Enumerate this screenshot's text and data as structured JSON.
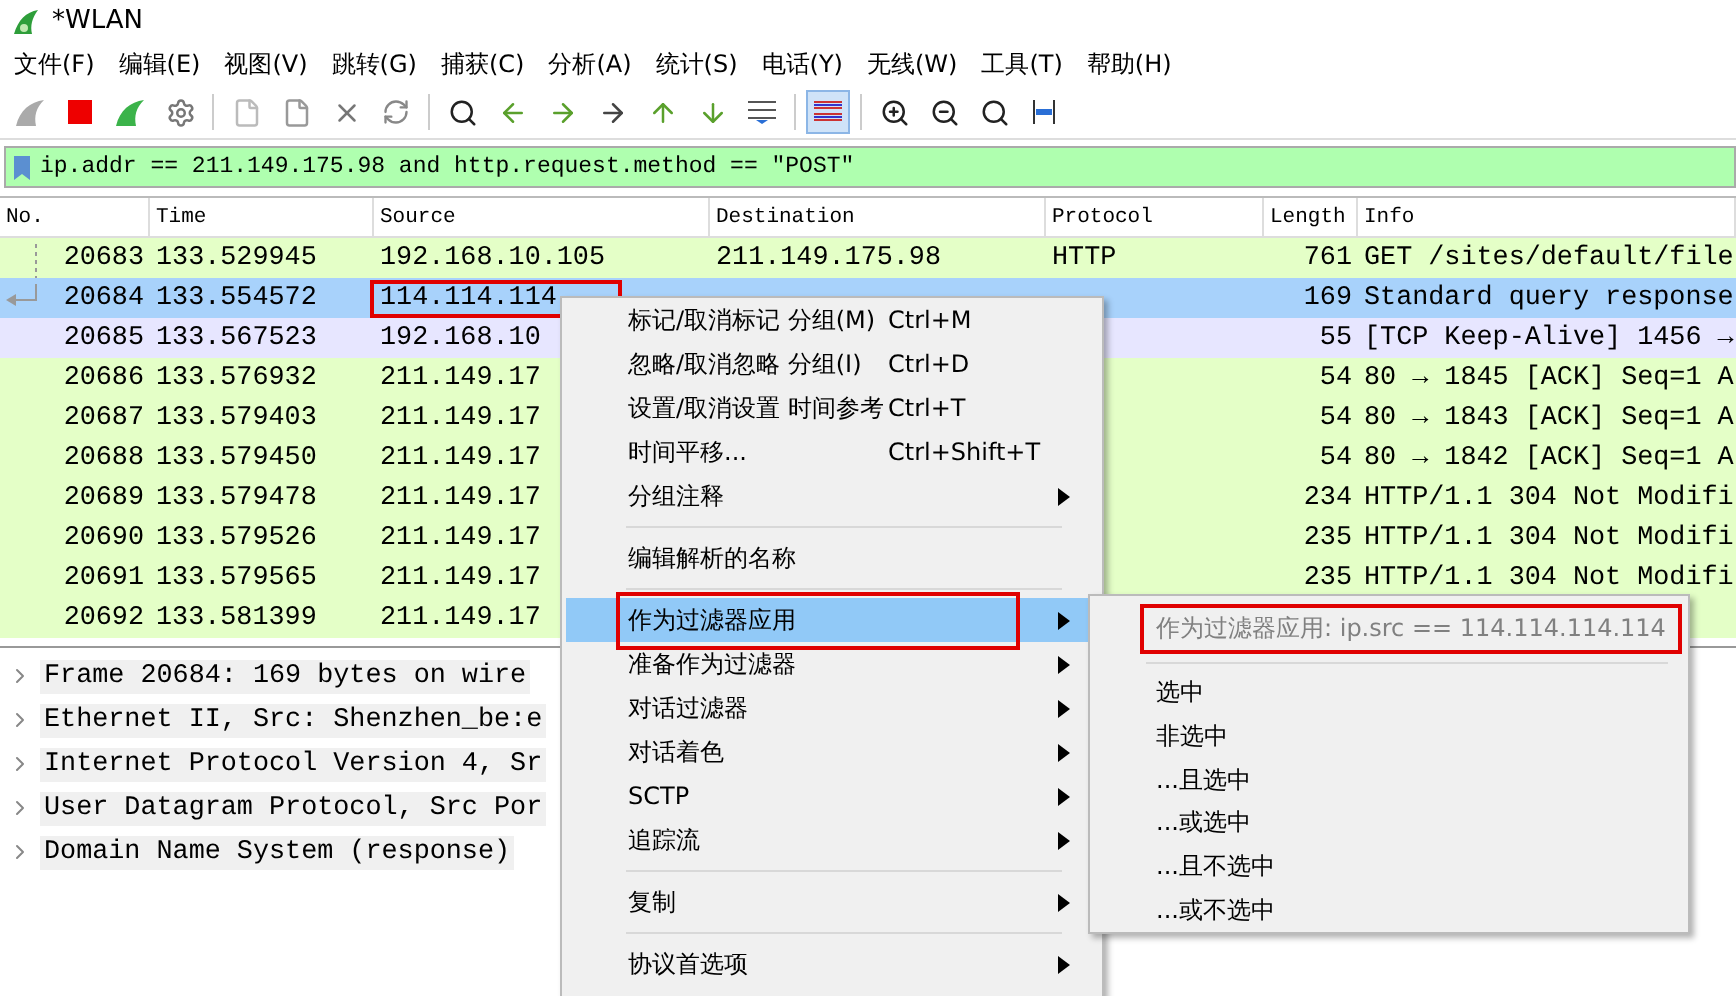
{
  "window": {
    "title": "*WLAN"
  },
  "menubar": [
    "文件(F)",
    "编辑(E)",
    "视图(V)",
    "跳转(G)",
    "捕获(C)",
    "分析(A)",
    "统计(S)",
    "电话(Y)",
    "无线(W)",
    "工具(T)",
    "帮助(H)"
  ],
  "filter": {
    "value": "ip.addr == 211.149.175.98 and http.request.method == \"POST\""
  },
  "table": {
    "columns": [
      "No.",
      "Time",
      "Source",
      "Destination",
      "Protocol",
      "Length",
      "Info"
    ],
    "rows": [
      {
        "cells": [
          "20683",
          "133.529945",
          "192.168.10.105",
          "211.149.175.98",
          "HTTP",
          "761",
          "GET /sites/default/file"
        ],
        "color": "#e4ffc7",
        "selected": false,
        "highlighted": false
      },
      {
        "cells": [
          "20684",
          "133.554572",
          "114.114.114",
          "",
          "",
          "169",
          "Standard query response"
        ],
        "selected": true,
        "highlighted": true
      },
      {
        "cells": [
          "20685",
          "133.567523",
          "192.168.10",
          "",
          "",
          "55",
          "[TCP Keep-Alive] 1456 →"
        ],
        "color": "#e7e6ff",
        "selected": false,
        "highlighted": false
      },
      {
        "cells": [
          "20686",
          "133.576932",
          "211.149.17",
          "",
          "",
          "54",
          "80 → 1845 [ACK] Seq=1 A"
        ],
        "color": "#e4ffc7",
        "selected": false,
        "highlighted": false
      },
      {
        "cells": [
          "20687",
          "133.579403",
          "211.149.17",
          "",
          "",
          "54",
          "80 → 1843 [ACK] Seq=1 A"
        ],
        "color": "#e4ffc7",
        "selected": false,
        "highlighted": false
      },
      {
        "cells": [
          "20688",
          "133.579450",
          "211.149.17",
          "",
          "",
          "54",
          "80 → 1842 [ACK] Seq=1 A"
        ],
        "color": "#e4ffc7",
        "selected": false,
        "highlighted": false
      },
      {
        "cells": [
          "20689",
          "133.579478",
          "211.149.17",
          "",
          "",
          "234",
          "HTTP/1.1 304 Not Modifi"
        ],
        "color": "#e4ffc7",
        "selected": false,
        "highlighted": false
      },
      {
        "cells": [
          "20690",
          "133.579526",
          "211.149.17",
          "",
          "",
          "235",
          "HTTP/1.1 304 Not Modifi"
        ],
        "color": "#e4ffc7",
        "selected": false,
        "highlighted": false
      },
      {
        "cells": [
          "20691",
          "133.579565",
          "211.149.17",
          "",
          "",
          "235",
          "HTTP/1.1 304 Not Modifi"
        ],
        "color": "#e4ffc7",
        "selected": false,
        "highlighted": false
      },
      {
        "cells": [
          "20692",
          "133.581399",
          "211.149.17",
          "",
          "",
          "",
          ""
        ],
        "color": "#e4ffc7",
        "selected": false,
        "highlighted": false
      }
    ]
  },
  "details": [
    {
      "text": "Frame 20684: 169 bytes on wire",
      "expanded": false
    },
    {
      "text": "Ethernet II, Src: Shenzhen_be:e",
      "expanded": false
    },
    {
      "text": "Internet Protocol Version 4, Sr",
      "expanded": false
    },
    {
      "text": "User Datagram Protocol, Src Por",
      "expanded": false
    },
    {
      "text": "Domain Name System (response)",
      "expanded": false
    }
  ],
  "context_menu": {
    "items": [
      {
        "kind": "item",
        "label": "标记/取消标记 分组(M)",
        "shortcut": "Ctrl+M",
        "submenu": false,
        "selected": false,
        "highlighted": false
      },
      {
        "kind": "item",
        "label": "忽略/取消忽略 分组(I)",
        "shortcut": "Ctrl+D",
        "submenu": false,
        "selected": false,
        "highlighted": false
      },
      {
        "kind": "item",
        "label": "设置/取消设置 时间参考",
        "shortcut": "Ctrl+T",
        "submenu": false,
        "selected": false,
        "highlighted": false
      },
      {
        "kind": "item",
        "label": "时间平移...",
        "shortcut": "Ctrl+Shift+T",
        "submenu": false,
        "selected": false,
        "highlighted": false
      },
      {
        "kind": "item",
        "label": "分组注释",
        "submenu": true,
        "selected": false,
        "highlighted": false
      },
      {
        "kind": "separator"
      },
      {
        "kind": "item",
        "label": "编辑解析的名称",
        "submenu": false,
        "selected": false,
        "highlighted": false
      },
      {
        "kind": "separator"
      },
      {
        "kind": "item",
        "label": "作为过滤器应用",
        "submenu": true,
        "selected": true,
        "highlighted": true
      },
      {
        "kind": "item",
        "label": "准备作为过滤器",
        "submenu": true,
        "selected": false,
        "highlighted": false
      },
      {
        "kind": "item",
        "label": "对话过滤器",
        "submenu": true,
        "selected": false,
        "highlighted": false
      },
      {
        "kind": "item",
        "label": "对话着色",
        "submenu": true,
        "selected": false,
        "highlighted": false
      },
      {
        "kind": "item",
        "label": "SCTP",
        "submenu": true,
        "selected": false,
        "highlighted": false
      },
      {
        "kind": "item",
        "label": "追踪流",
        "submenu": true,
        "selected": false,
        "highlighted": false
      },
      {
        "kind": "separator"
      },
      {
        "kind": "item",
        "label": "复制",
        "submenu": true,
        "selected": false,
        "highlighted": false
      },
      {
        "kind": "separator"
      },
      {
        "kind": "item",
        "label": "协议首选项",
        "submenu": true,
        "selected": false,
        "highlighted": false
      }
    ]
  },
  "submenu": {
    "header": {
      "label": "作为过滤器应用: ip.src == 114.114.114.114",
      "disabled": true,
      "highlighted": true
    },
    "items": [
      "选中",
      "非选中",
      "...且选中",
      "...或选中",
      "...且不选中",
      "...或不选中"
    ]
  }
}
